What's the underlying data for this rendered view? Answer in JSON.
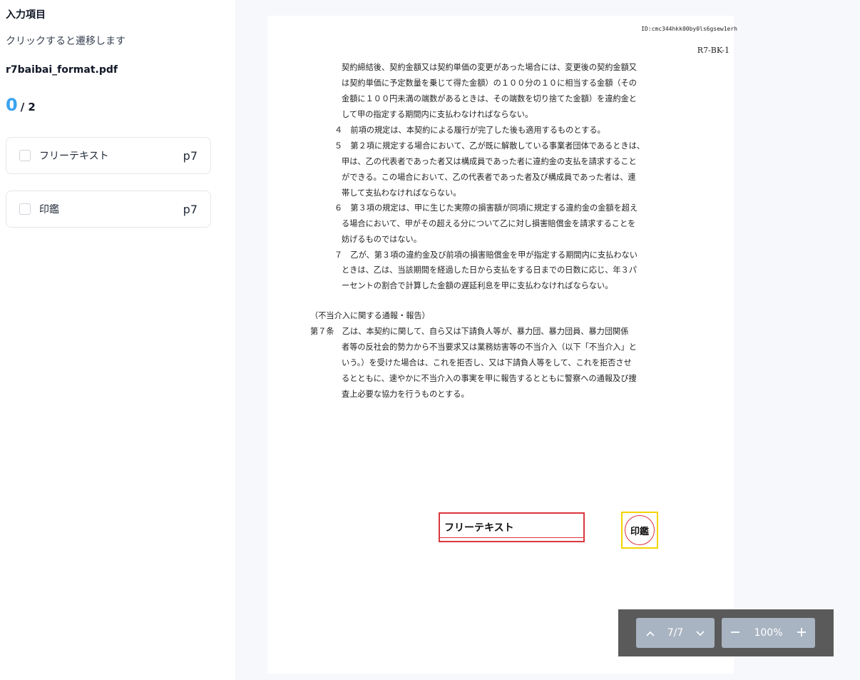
{
  "sidebar": {
    "section_title": "入力項目",
    "hint": "クリックすると遷移します",
    "filename": "r7baibai_format.pdf",
    "progress": {
      "done": "0",
      "total": "/ 2"
    },
    "fields": [
      {
        "label": "フリーテキスト",
        "page": "p7",
        "checked": false
      },
      {
        "label": "印鑑",
        "page": "p7",
        "checked": false
      }
    ]
  },
  "document": {
    "id": "ID:cmc344hkk00by0ls6gsew1erh",
    "code": "R7-BK-1",
    "lines": [
      "契約締結後、契約金額又は契約単価の変更があった場合には、変更後の契約金額又",
      "は契約単価に予定数量を乗じて得た金額）の１００分の１０に相当する金額（その",
      "金額に１００円未満の端数があるときは、その端数を切り捨てた金額）を違約金と",
      "して甲の指定する期間内に支払わなければならない。",
      "４　前項の規定は、本契約による履行が完了した後も適用するものとする。",
      "５　第２項に規定する場合において、乙が既に解散している事業者団体であるときは、",
      "甲は、乙の代表者であった者又は構成員であった者に違約金の支払を請求すること",
      "ができる。この場合において、乙の代表者であった者及び構成員であった者は、連",
      "帯して支払わなければならない。",
      "６　第３項の規定は、甲に生じた実際の損害額が同項に規定する違約金の金額を超え",
      "る場合において、甲がその超える分について乙に対し損害賠償金を請求することを",
      "妨げるものではない。",
      "７　乙が、第３項の違約金及び前項の損害賠償金を甲が指定する期間内に支払わない",
      "ときは、乙は、当該期間を経過した日から支払をする日までの日数に応じ、年３パ",
      "ーセントの割合で計算した金額の遅延利息を甲に支払わなければならない。",
      "（不当介入に関する通報・報告）",
      "第７条　乙は、本契約に関して、自ら又は下請負人等が、暴力団、暴力団員、暴力団関係",
      "者等の反社会的勢力から不当要求又は業務妨害等の不当介入（以下「不当介入」と",
      "いう。）を受けた場合は、これを拒否し、又は下請負人等をして、これを拒否させ",
      "るとともに、速やかに不当介入の事実を甲に報告するとともに警察への通報及び捜",
      "査上必要な協力を行うものとする。"
    ],
    "field_overlays": {
      "text_label": "フリーテキスト",
      "seal_label": "印鑑"
    }
  },
  "toolbar": {
    "prev_icon": "chevron-up-icon",
    "page_indicator": "7/7",
    "next_icon": "chevron-down-icon",
    "zoom_out_icon": "minus-icon",
    "zoom_level": "100%",
    "zoom_in_icon": "plus-icon"
  }
}
